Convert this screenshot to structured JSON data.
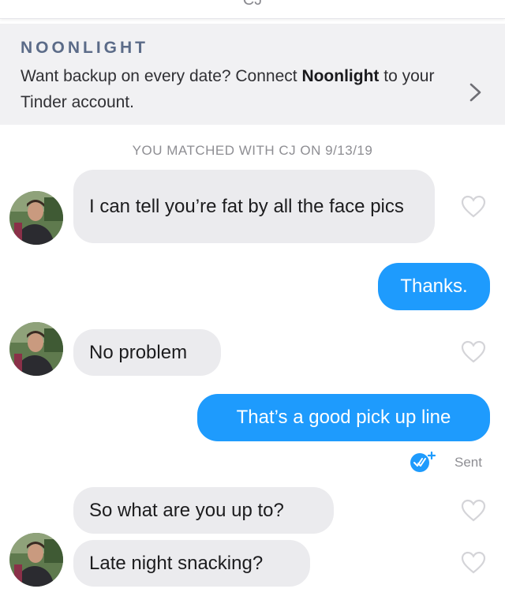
{
  "header": {
    "name": "CJ"
  },
  "banner": {
    "brand": "NOONLIGHT",
    "text_before": "Want backup on every date? Connect ",
    "text_bold": "Noonlight",
    "text_after": " to your Tinder account."
  },
  "match_text": "YOU MATCHED WITH CJ ON 9/13/19",
  "messages": [
    {
      "text": "I can tell you’re fat by all the face pics",
      "direction": "incoming"
    },
    {
      "text": "Thanks.",
      "direction": "outgoing"
    },
    {
      "text": "No problem",
      "direction": "incoming"
    },
    {
      "text": "That’s a good pick up line",
      "direction": "outgoing"
    },
    {
      "text": "So what are you up to?",
      "direction": "incoming"
    },
    {
      "text": "Late night snacking?",
      "direction": "incoming"
    }
  ],
  "status": {
    "sent_label": "Sent",
    "icon": "double-check-icon"
  },
  "colors": {
    "outgoing_bubble": "#1e9bfd",
    "incoming_bubble": "#ebebee",
    "banner_bg": "#f1f1f3",
    "brand": "#5b6b88"
  }
}
